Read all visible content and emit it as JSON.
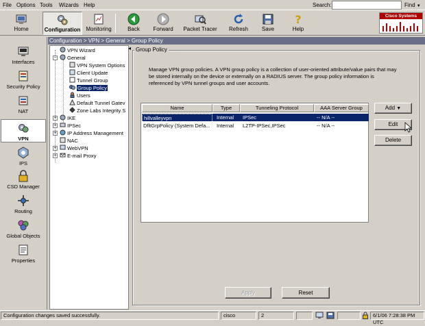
{
  "menubar": {
    "items": [
      "File",
      "Options",
      "Tools",
      "Wizards",
      "Help"
    ],
    "search_label": "Search:",
    "search_value": "",
    "find_label": "Find"
  },
  "toolbar": {
    "home": "Home",
    "configuration": "Configuration",
    "monitoring": "Monitoring",
    "back": "Back",
    "forward": "Forward",
    "packet_tracer": "Packet Tracer",
    "refresh": "Refresh",
    "save": "Save",
    "help": "Help",
    "logo_text": "Cisco Systems"
  },
  "nav": {
    "items": [
      "Interfaces",
      "Security Policy",
      "NAT",
      "VPN",
      "IPS",
      "CSD Manager",
      "Routing",
      "Global Objects",
      "Properties"
    ],
    "active": "VPN"
  },
  "breadcrumb": "Configuration > VPN > General > Group Policy",
  "tree": {
    "vpn_wizard": "VPN Wizard",
    "general": "General",
    "vpn_system_options": "VPN System Options",
    "client_update": "Client Update",
    "tunnel_group": "Tunnel Group",
    "group_policy": "Group Policy",
    "users": "Users",
    "default_tunnel_gateway": "Default Tunnel Gatev",
    "zone_labs": "Zone Labs Integrity S",
    "ike": "IKE",
    "ipsec": "IPSec",
    "ip_address_management": "IP Address Management",
    "nac": "NAC",
    "webvpn": "WebVPN",
    "email_proxy": "E-mail Proxy"
  },
  "panel": {
    "title": "Group Policy",
    "description": "Manage VPN group policies. A VPN group policy is a collection of user-oriented attribute/value pairs that may be stored internally on the device or externally on a RADIUS server. The group policy information is referenced by VPN tunnel groups and user accounts."
  },
  "table": {
    "headers": [
      "Name",
      "Type",
      "Tunneling Protocol",
      "AAA Server Group"
    ],
    "rows": [
      [
        "hillvalleyvpn",
        "Internal",
        "IPSec",
        "-- N/A --"
      ],
      [
        "DfltGrpPolicy (System Defa...",
        "Internal",
        "L2TP-IPSec,IPSec",
        "-- N/A --"
      ]
    ]
  },
  "buttons": {
    "add": "Add",
    "edit": "Edit",
    "delete": "Delete",
    "apply": "Apply",
    "reset": "Reset"
  },
  "status": {
    "message": "Configuration changes saved successfully.",
    "user": "cisco",
    "count": "2",
    "datetime": "6/1/06 7:28:38 PM UTC"
  }
}
